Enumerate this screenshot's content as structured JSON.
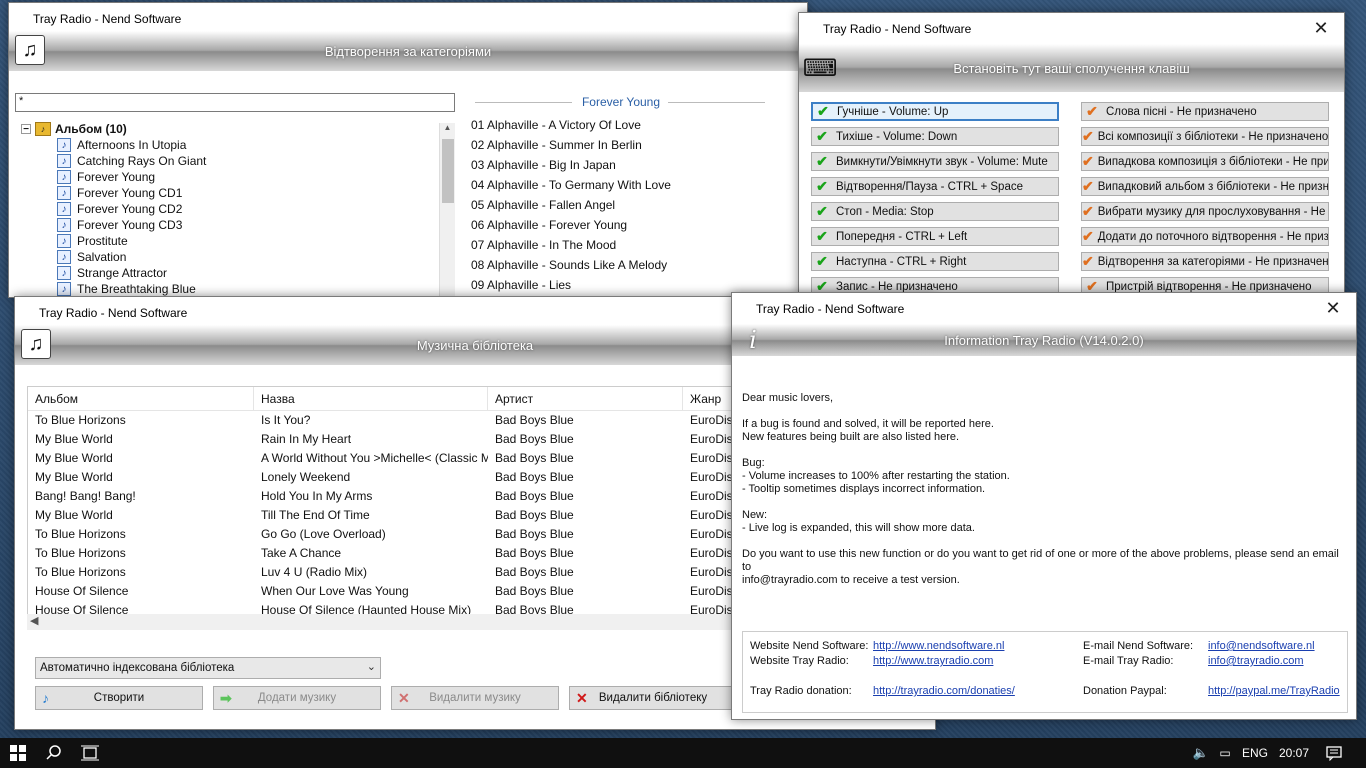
{
  "app_title": "Tray Radio - Nend Software",
  "categories_window": {
    "title": "Tray Radio - Nend Software",
    "banner": "Відтворення за категоріями",
    "search_value": "*",
    "tree_root": "Альбом (10)",
    "tree_items": [
      "Afternoons In Utopia",
      "Catching Rays On Giant",
      "Forever Young",
      "Forever Young CD1",
      "Forever Young CD2",
      "Forever Young CD3",
      "Prostitute",
      "Salvation",
      "Strange Attractor",
      "The Breathtaking Blue"
    ],
    "selected_album": "Forever Young",
    "tracks": [
      "01 Alphaville - A Victory Of Love",
      "02 Alphaville - Summer In Berlin",
      "03 Alphaville - Big In Japan",
      "04 Alphaville - To Germany With Love",
      "05 Alphaville - Fallen Angel",
      "06 Alphaville - Forever Young",
      "07 Alphaville - In The Mood",
      "08 Alphaville - Sounds Like A Melody",
      "09 Alphaville - Lies"
    ]
  },
  "hotkeys_window": {
    "title": "Tray Radio - Nend Software",
    "close": "✕",
    "banner": "Встановіть тут ваші сполучення клавіш",
    "left": [
      {
        "label": "Гучніше  -  Volume: Up",
        "status": "ok"
      },
      {
        "label": "Тихіше  -  Volume: Down",
        "status": "ok"
      },
      {
        "label": "Вимкнути/Увімкнути звук  -  Volume: Mute",
        "status": "ok"
      },
      {
        "label": "Відтворення/Пауза  -  CTRL + Space",
        "status": "ok"
      },
      {
        "label": "Стоп  -  Media: Stop",
        "status": "ok"
      },
      {
        "label": "Попередня  -  CTRL + Left",
        "status": "ok"
      },
      {
        "label": "Наступна  -  CTRL + Right",
        "status": "ok"
      },
      {
        "label": "Запис  -  Не призначено",
        "status": "ok"
      }
    ],
    "right": [
      {
        "label": "Слова пісні  -  Не призначено",
        "status": "warn"
      },
      {
        "label": "Всі композиції з бібліотеки  -  Не призначено",
        "status": "warn"
      },
      {
        "label": "Випадкова композиція з бібліотеки  -  Не призначено",
        "status": "warn"
      },
      {
        "label": "Випадковий альбом з бібліотеки  -  Не призначено",
        "status": "warn"
      },
      {
        "label": "Вибрати музику для прослуховування  -  Не призначено",
        "status": "warn"
      },
      {
        "label": "Додати до поточного відтворення  -  Не призначено",
        "status": "warn"
      },
      {
        "label": "Відтворення за категоріями  -  Не призначено",
        "status": "warn"
      },
      {
        "label": "Пристрій відтворення  -  Не призначено",
        "status": "warn"
      }
    ]
  },
  "library_window": {
    "title": "Tray Radio - Nend Software",
    "banner": "Музична бібліотека",
    "columns": [
      "Альбом",
      "Назва",
      "Артист",
      "Жанр"
    ],
    "rows": [
      [
        "To Blue Horizons",
        "Is It You?",
        "Bad Boys Blue",
        "EuroDisco"
      ],
      [
        "My Blue World",
        "Rain In My Heart",
        "Bad Boys Blue",
        "EuroDisco"
      ],
      [
        "My Blue World",
        "A World Without You >Michelle< (Classic Mix)",
        "Bad Boys Blue",
        "EuroDisco"
      ],
      [
        "My Blue World",
        "Lonely Weekend",
        "Bad Boys Blue",
        "EuroDisco"
      ],
      [
        "Bang! Bang! Bang!",
        "Hold You In My Arms",
        "Bad Boys Blue",
        "EuroDisco"
      ],
      [
        "My Blue World",
        "Till The End Of Time",
        "Bad Boys Blue",
        "EuroDisco"
      ],
      [
        "To Blue Horizons",
        "Go Go (Love Overload)",
        "Bad Boys Blue",
        "EuroDisco"
      ],
      [
        "To Blue Horizons",
        "Take A Chance",
        "Bad Boys Blue",
        "EuroDisco"
      ],
      [
        "To Blue Horizons",
        "Luv 4 U (Radio Mix)",
        "Bad Boys Blue",
        "EuroDisco"
      ],
      [
        "House Of Silence",
        "When Our Love Was Young",
        "Bad Boys Blue",
        "EuroDisco"
      ],
      [
        "House Of Silence",
        "House Of Silence (Haunted House Mix)",
        "Bad Boys Blue",
        "EuroDisco"
      ]
    ],
    "combo_value": "Автоматично індексована бібліотека",
    "btn_create": "Створити",
    "btn_add": "Додати музику",
    "btn_remove": "Видалити музику",
    "btn_delete_lib": "Видалити бібліотеку"
  },
  "info_window": {
    "title": "Tray Radio - Nend Software",
    "close": "✕",
    "banner": "Information Tray Radio (V14.0.2.0)",
    "paragraphs": [
      "Dear music lovers,",
      "If a bug is found and solved, it will be reported here.\nNew features being built are also listed here.",
      "Bug:\n- Volume increases to 100% after restarting the station.\n- Tooltip sometimes displays incorrect information.",
      "New:\n- Live log is expanded, this will show more data.",
      "Do you want to use this new function or do you want to get rid of one or more of the above problems, please send an email to\ninfo@trayradio.com to receive a test version."
    ],
    "website_nend_label": "Website Nend Software:",
    "website_nend_url": "http://www.nendsoftware.nl",
    "website_tray_label": "Website Tray Radio:",
    "website_tray_url": "http://www.trayradio.com",
    "donation_label": "Tray Radio donation:",
    "donation_url": "http://trayradio.com/donaties/",
    "email_nend_label": "E-mail Nend Software:",
    "email_nend": "info@nendsoftware.nl",
    "email_tray_label": "E-mail Tray Radio:",
    "email_tray": "info@trayradio.com",
    "paypal_label": "Donation Paypal:",
    "paypal_url": "http://paypal.me/TrayRadio"
  },
  "taskbar": {
    "language": "ENG",
    "time": "20:07"
  },
  "colors": {
    "accent": "#3c7fc6",
    "ok_check": "#1aa41a",
    "warn_check": "#e07020",
    "link": "#1a3fb0"
  }
}
